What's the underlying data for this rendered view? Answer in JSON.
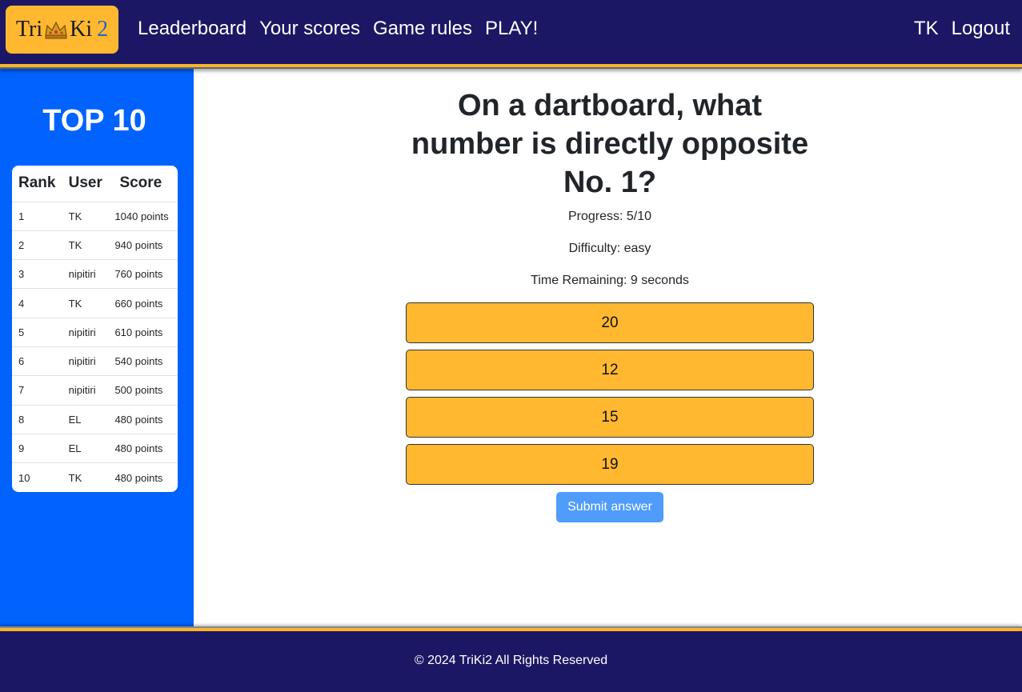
{
  "header": {
    "logo": {
      "part1": "Tri",
      "part2": "Ki",
      "part3": "2"
    },
    "nav": [
      "Leaderboard",
      "Your scores",
      "Game rules",
      "PLAY!"
    ],
    "user": "TK",
    "logout": "Logout"
  },
  "sidebar": {
    "title": "TOP 10",
    "columns": [
      "Rank",
      "User",
      "Score"
    ],
    "rows": [
      {
        "rank": "1",
        "user": "TK",
        "score": "1040 points"
      },
      {
        "rank": "2",
        "user": "TK",
        "score": "940 points"
      },
      {
        "rank": "3",
        "user": "nipitiri",
        "score": "760 points"
      },
      {
        "rank": "4",
        "user": "TK",
        "score": "660 points"
      },
      {
        "rank": "5",
        "user": "nipitiri",
        "score": "610 points"
      },
      {
        "rank": "6",
        "user": "nipitiri",
        "score": "540 points"
      },
      {
        "rank": "7",
        "user": "nipitiri",
        "score": "500 points"
      },
      {
        "rank": "8",
        "user": "EL",
        "score": "480 points"
      },
      {
        "rank": "9",
        "user": "EL",
        "score": "480 points"
      },
      {
        "rank": "10",
        "user": "TK",
        "score": "480 points"
      }
    ]
  },
  "quiz": {
    "question": "On a dartboard, what number is directly opposite No. 1?",
    "progress": "Progress: 5/10",
    "difficulty": "Difficulty: easy",
    "time": "Time Remaining: 9 seconds",
    "answers": [
      "20",
      "12",
      "15",
      "19"
    ],
    "submit": "Submit answer"
  },
  "footer": {
    "copyright": "© 2024 TriKi2 All Rights Reserved"
  },
  "colors": {
    "navy": "#1c1764",
    "gold": "#ffb830",
    "sidebar_blue": "#0162fe",
    "submit_blue": "#4f9cfb"
  }
}
